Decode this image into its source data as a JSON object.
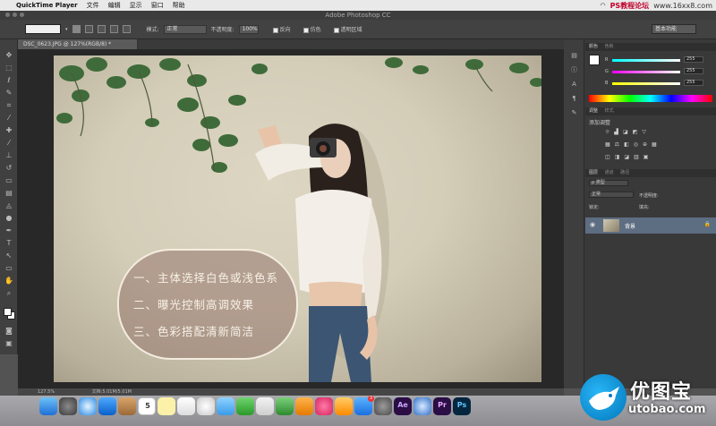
{
  "menubar": {
    "app_name": "QuickTime Player",
    "items": [
      "文件",
      "编辑",
      "显示",
      "窗口",
      "帮助"
    ],
    "watermark_left": "PS教程论坛",
    "watermark_right": "www.16xx8.com"
  },
  "window": {
    "title": "Adobe Photoshop CC"
  },
  "options": {
    "mode_label": "模式:",
    "mode_value": "正常",
    "opacity_label": "不透明度:",
    "opacity_value": "100%",
    "reverse_label": "反向",
    "dither_label": "仿色",
    "transparency_label": "透明区域",
    "workspace": "基本功能"
  },
  "document": {
    "tab_title": "DSC_0623.JPG @ 127%(RGB/8) *",
    "zoom": "127.5%",
    "doc_size": "文档:5.01M/5.01M"
  },
  "overlay_text": {
    "line1": "一、主体选择白色或浅色系",
    "line2": "二、曝光控制高调效果",
    "line3": "三、色彩搭配清新简洁"
  },
  "panels": {
    "color_tabs": [
      "颜色",
      "色板"
    ],
    "rgb": {
      "r": "255",
      "g": "255",
      "b": "255"
    },
    "adjust_tabs": [
      "调整",
      "样式"
    ],
    "adjust_heading": "添加调整",
    "layers_tabs": [
      "图层",
      "通道",
      "路径"
    ],
    "layers_kind": "ρ 类型",
    "layers_blend": "正常",
    "layers_opacity_label": "不透明度:",
    "layers_lock_label": "锁定:",
    "layers_fill_label": "填充:",
    "layer_name": "背景"
  },
  "dock": {
    "calendar_day": "5",
    "ae_label": "Ae",
    "pr_label": "Pr",
    "ps_label": "Ps",
    "notification_count": "3"
  },
  "logo": {
    "brand": "优图宝",
    "domain": "utobao.com"
  },
  "colors": {
    "bubble": "#9a7a72",
    "layer_selected": "#5d6d82",
    "ps_ui": "#535353"
  }
}
